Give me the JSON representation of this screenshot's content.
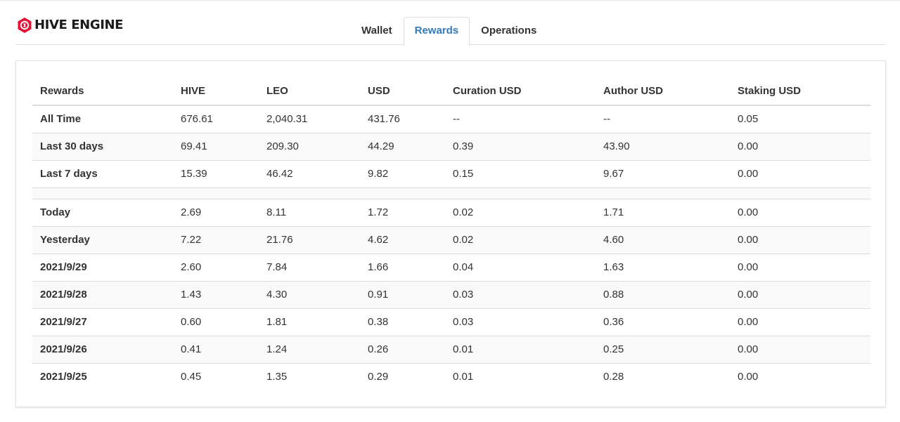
{
  "brand": {
    "name": "HIVE ENGINE",
    "icon": "hive-engine-logo-icon",
    "color": "#e31337"
  },
  "tabs": [
    {
      "label": "Wallet",
      "active": false
    },
    {
      "label": "Rewards",
      "active": true
    },
    {
      "label": "Operations",
      "active": false
    }
  ],
  "colors": {
    "accent": "#337ab7",
    "border": "#dddddd",
    "stripe": "#f9f9f9"
  },
  "table": {
    "headers": [
      "Rewards",
      "HIVE",
      "LEO",
      "USD",
      "Curation USD",
      "Author USD",
      "Staking USD"
    ],
    "summary_rows": [
      [
        "All Time",
        "676.61",
        "2,040.31",
        "431.76",
        "--",
        "--",
        "0.05"
      ],
      [
        "Last 30 days",
        "69.41",
        "209.30",
        "44.29",
        "0.39",
        "43.90",
        "0.00"
      ],
      [
        "Last 7 days",
        "15.39",
        "46.42",
        "9.82",
        "0.15",
        "9.67",
        "0.00"
      ]
    ],
    "daily_rows": [
      [
        "Today",
        "2.69",
        "8.11",
        "1.72",
        "0.02",
        "1.71",
        "0.00"
      ],
      [
        "Yesterday",
        "7.22",
        "21.76",
        "4.62",
        "0.02",
        "4.60",
        "0.00"
      ],
      [
        "2021/9/29",
        "2.60",
        "7.84",
        "1.66",
        "0.04",
        "1.63",
        "0.00"
      ],
      [
        "2021/9/28",
        "1.43",
        "4.30",
        "0.91",
        "0.03",
        "0.88",
        "0.00"
      ],
      [
        "2021/9/27",
        "0.60",
        "1.81",
        "0.38",
        "0.03",
        "0.36",
        "0.00"
      ],
      [
        "2021/9/26",
        "0.41",
        "1.24",
        "0.26",
        "0.01",
        "0.25",
        "0.00"
      ],
      [
        "2021/9/25",
        "0.45",
        "1.35",
        "0.29",
        "0.01",
        "0.28",
        "0.00"
      ]
    ]
  }
}
